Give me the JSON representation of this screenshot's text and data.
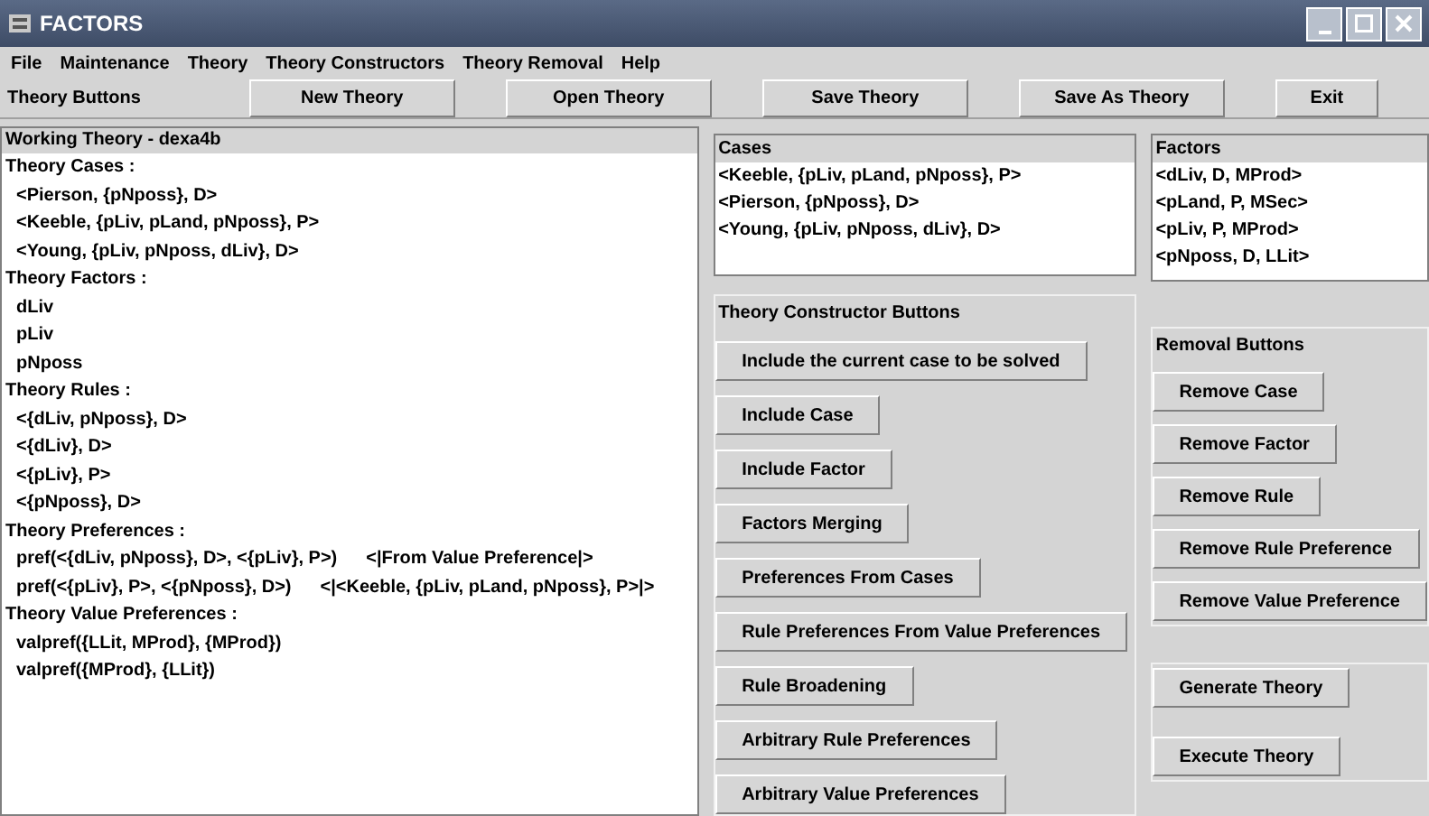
{
  "window": {
    "title": "FACTORS"
  },
  "menu": [
    "File",
    "Maintenance",
    "Theory",
    "Theory Constructors",
    "Theory Removal",
    "Help"
  ],
  "toolbar": {
    "label": "Theory Buttons",
    "buttons": [
      "New Theory",
      "Open Theory",
      "Save Theory",
      "Save As Theory",
      "Exit"
    ]
  },
  "working_theory": {
    "title": "Working Theory - dexa4b",
    "lines": [
      {
        "kind": "heading",
        "text": "Theory Cases :"
      },
      {
        "kind": "item",
        "text": "<Pierson, {pNposs}, D>"
      },
      {
        "kind": "item",
        "text": "<Keeble, {pLiv, pLand, pNposs}, P>"
      },
      {
        "kind": "item",
        "text": "<Young, {pLiv, pNposs, dLiv}, D>"
      },
      {
        "kind": "heading",
        "text": "Theory Factors :"
      },
      {
        "kind": "item",
        "text": "dLiv"
      },
      {
        "kind": "item",
        "text": "pLiv"
      },
      {
        "kind": "item",
        "text": "pNposs"
      },
      {
        "kind": "heading",
        "text": "Theory Rules :"
      },
      {
        "kind": "item",
        "text": "<{dLiv, pNposs}, D>"
      },
      {
        "kind": "item",
        "text": "<{dLiv}, D>"
      },
      {
        "kind": "item",
        "text": "<{pLiv}, P>"
      },
      {
        "kind": "item",
        "text": "<{pNposs}, D>"
      },
      {
        "kind": "heading",
        "text": "Theory Preferences :"
      },
      {
        "kind": "pref",
        "text": "pref(<{dLiv, pNposs}, D>, <{pLiv}, P>)",
        "source": "<|From Value Preference|>"
      },
      {
        "kind": "pref",
        "text": "pref(<{pLiv}, P>, <{pNposs}, D>)",
        "source": "<|<Keeble, {pLiv, pLand, pNposs}, P>|>"
      },
      {
        "kind": "heading",
        "text": "Theory Value Preferences :"
      },
      {
        "kind": "item",
        "text": "valpref({LLit, MProd}, {MProd})"
      },
      {
        "kind": "item",
        "text": "valpref({MProd}, {LLit})"
      }
    ]
  },
  "cases": {
    "title": "Cases",
    "items": [
      "<Keeble, {pLiv, pLand, pNposs}, P>",
      "<Pierson, {pNposs}, D>",
      "<Young, {pLiv, pNposs, dLiv}, D>"
    ]
  },
  "factors": {
    "title": "Factors",
    "items": [
      "<dLiv, D, MProd>",
      "<pLand, P, MSec>",
      "<pLiv, P, MProd>",
      "<pNposs, D, LLit>"
    ]
  },
  "constructor_buttons": {
    "title": "Theory Constructor Buttons",
    "buttons": [
      "Include the current case to be solved",
      "Include Case",
      "Include Factor",
      "Factors Merging",
      "Preferences From Cases",
      "Rule Preferences From Value Preferences",
      "Rule Broadening",
      "Arbitrary Rule Preferences",
      "Arbitrary Value Preferences"
    ]
  },
  "removal_buttons": {
    "title": "Removal Buttons",
    "buttons": [
      "Remove Case",
      "Remove Factor",
      "Remove Rule",
      "Remove Rule Preference",
      "Remove Value Preference"
    ]
  },
  "theory_actions": [
    "Generate Theory",
    "Execute Theory"
  ]
}
